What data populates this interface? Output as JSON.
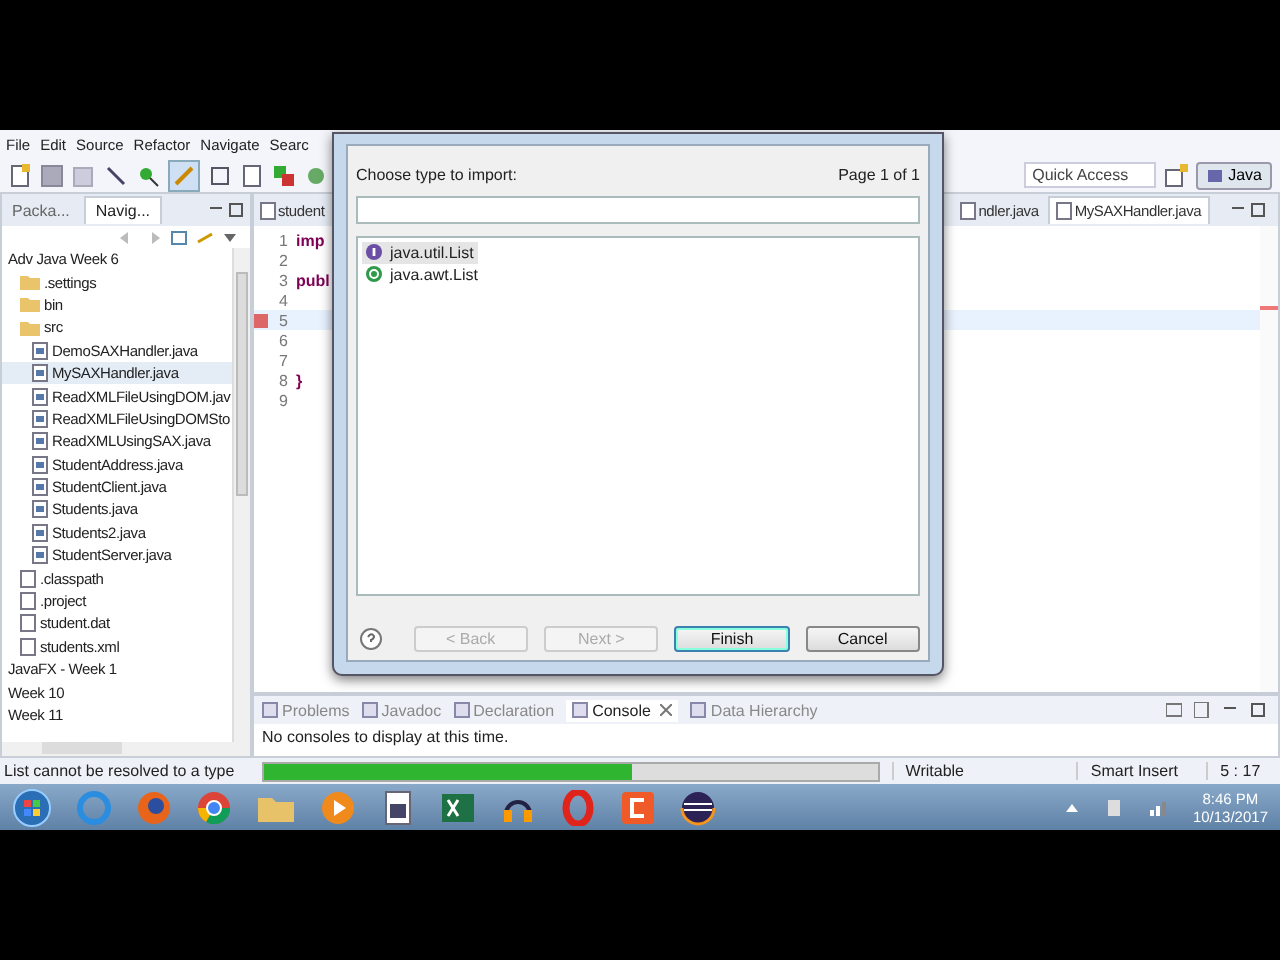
{
  "menu": [
    "File",
    "Edit",
    "Source",
    "Refactor",
    "Navigate",
    "Searc"
  ],
  "quick_access": {
    "placeholder": "Quick Access"
  },
  "perspective": {
    "label": "Java",
    "selected": true
  },
  "left_pane": {
    "tabs": [
      {
        "label": "Packa...",
        "selected": false
      },
      {
        "label": "Navig...",
        "selected": true
      }
    ],
    "tree": [
      {
        "label": "Adv Java Week 6",
        "selected": false,
        "children": [
          {
            "label": ".settings",
            "kind": "folder",
            "selected": false
          },
          {
            "label": "bin",
            "kind": "folder",
            "selected": false
          },
          {
            "label": "src",
            "kind": "folder",
            "selected": false,
            "children": [
              {
                "label": "DemoSAXHandler.java",
                "kind": "java",
                "selected": false
              },
              {
                "label": "MySAXHandler.java",
                "kind": "java",
                "selected": true
              },
              {
                "label": "ReadXMLFileUsingDOM.jav",
                "kind": "java",
                "selected": false
              },
              {
                "label": "ReadXMLFileUsingDOMSto",
                "kind": "java",
                "selected": false
              },
              {
                "label": "ReadXMLUsingSAX.java",
                "kind": "java",
                "selected": false
              },
              {
                "label": "StudentAddress.java",
                "kind": "java",
                "selected": false
              },
              {
                "label": "StudentClient.java",
                "kind": "java",
                "selected": false
              },
              {
                "label": "Students.java",
                "kind": "java",
                "selected": false
              },
              {
                "label": "Students2.java",
                "kind": "java",
                "selected": false
              },
              {
                "label": "StudentServer.java",
                "kind": "java",
                "selected": false
              }
            ]
          },
          {
            "label": ".classpath",
            "kind": "file",
            "selected": false
          },
          {
            "label": ".project",
            "kind": "file",
            "selected": false
          },
          {
            "label": "student.dat",
            "kind": "file",
            "selected": false
          },
          {
            "label": "students.xml",
            "kind": "file",
            "selected": false
          }
        ]
      },
      {
        "label": "JavaFX - Week 1",
        "selected": false
      },
      {
        "label": "Week 10",
        "selected": false
      },
      {
        "label": "Week 11",
        "selected": false
      }
    ]
  },
  "editor": {
    "tabs": [
      {
        "label": "student",
        "selected": false
      },
      {
        "label": "ndler.java",
        "selected": false
      },
      {
        "label": "MySAXHandler.java",
        "selected": true
      }
    ],
    "lines": [
      {
        "number": "1",
        "text": "imp",
        "error": false
      },
      {
        "number": "2",
        "error": false
      },
      {
        "number": "3",
        "text": "publ",
        "error": false
      },
      {
        "number": "4",
        "error": false
      },
      {
        "number": "5",
        "error": true
      },
      {
        "number": "6",
        "error": false
      },
      {
        "number": "7",
        "error": false
      },
      {
        "number": "8",
        "text": "}",
        "error": false
      },
      {
        "number": "9",
        "error": false
      }
    ]
  },
  "dialog": {
    "prompt": "Choose type to import:",
    "page": "Page 1 of 1",
    "types": [
      {
        "name": "java.util.List",
        "kind": "interface",
        "selected": true
      },
      {
        "name": "java.awt.List",
        "kind": "class",
        "selected": false
      }
    ],
    "buttons": [
      {
        "label": "< Back",
        "disabled": true,
        "default": false
      },
      {
        "label": "Next >",
        "disabled": true,
        "default": false
      },
      {
        "label": "Finish",
        "disabled": false,
        "default": true
      },
      {
        "label": "Cancel",
        "disabled": false,
        "default": false
      }
    ]
  },
  "bottom_panel": {
    "tabs": [
      {
        "label": "Problems",
        "selected": false
      },
      {
        "label": "Javadoc",
        "selected": false
      },
      {
        "label": "Declaration",
        "selected": false
      },
      {
        "label": "Console",
        "selected": true
      },
      {
        "label": "Data Hierarchy",
        "selected": false
      }
    ],
    "message": "No consoles to display at this time."
  },
  "status_bar": {
    "message": "List cannot be resolved to a type",
    "progress": {
      "level": 0.6
    },
    "mode": "Writable",
    "insert": "Smart Insert",
    "position": "5 : 17"
  },
  "taskbar": {
    "time": "8:46 PM",
    "date": "10/13/2017"
  }
}
